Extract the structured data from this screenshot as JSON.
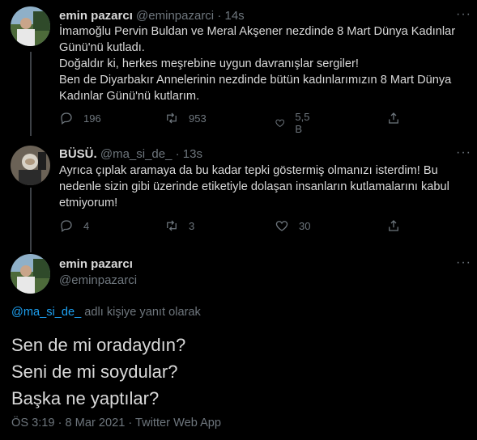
{
  "tweet1": {
    "name": "emin pazarcı",
    "handle": "@eminpazarci",
    "time": "14s",
    "text": [
      "İmamoğlu Pervin Buldan ve Meral Akşener nezdinde 8 Mart Dünya Kadınlar",
      "Günü'nü kutladı.",
      "Doğaldır ki, herkes meşrebine uygun davranışlar sergiler!",
      "Ben de Diyarbakır Annelerinin nezdinde bütün kadınlarımızın 8 Mart Dünya",
      "Kadınlar Günü'nü kutlarım."
    ],
    "replies": "196",
    "retweets": "953",
    "likes": "5,5 B"
  },
  "tweet2": {
    "name": "BÜSÜ.",
    "handle": "@ma_si_de_",
    "time": "13s",
    "text": [
      "Ayrıca çıplak aramaya da bu kadar tepki göstermiş olmanızı isterdim! Bu",
      "nedenle sizin gibi üzerinde etiketiyle dolaşan insanların kutlamalarını kabul",
      "etmiyorum!"
    ],
    "replies": "4",
    "retweets": "3",
    "likes": "30"
  },
  "main_tweet": {
    "name": "emin pazarcı",
    "handle": "@eminpazarci",
    "reply_mention": "@ma_si_de_",
    "reply_suffix": " adlı kişiye yanıt olarak",
    "text": [
      "Sen de mi oradaydın?",
      "Seni de mi soydular?",
      "Başka ne yaptılar?"
    ],
    "meta": "ÖS 3:19 · 8 Mar 2021 · Twitter Web App"
  },
  "icons": [
    "more-icon",
    "reply-icon",
    "retweet-icon",
    "like-icon",
    "share-icon"
  ],
  "colors": {
    "background": "#000000",
    "text": "#d9d9d9",
    "muted": "#6e767d",
    "link": "#1da1f2",
    "thread_line": "#3d4146"
  }
}
